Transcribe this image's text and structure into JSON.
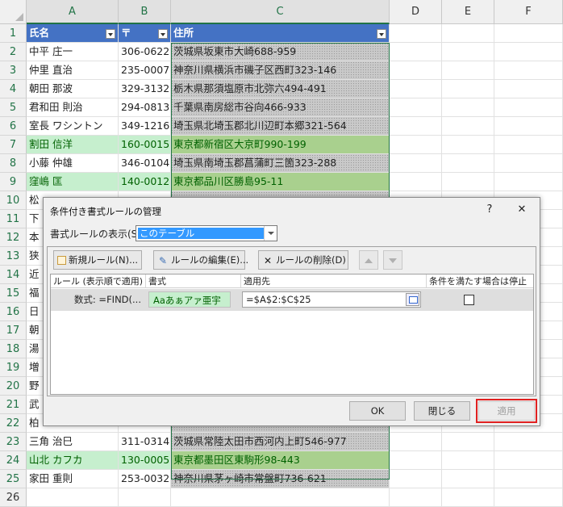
{
  "columns": [
    "A",
    "B",
    "C",
    "D",
    "E",
    "F"
  ],
  "rows": [
    {
      "n": "1",
      "a": "氏名",
      "b": "〒",
      "c": "住所",
      "header": true
    },
    {
      "n": "2",
      "a": "中平 庄一",
      "b": "306-0622",
      "c": "茨城県坂東市大崎688-959"
    },
    {
      "n": "3",
      "a": "仲里 直治",
      "b": "235-0007",
      "c": "神奈川県横浜市磯子区西町323-146"
    },
    {
      "n": "4",
      "a": "朝田 那波",
      "b": "329-3132",
      "c": "栃木県那須塩原市北弥六494-491"
    },
    {
      "n": "5",
      "a": "君和田 則治",
      "b": "294-0813",
      "c": "千葉県南房総市谷向466-933"
    },
    {
      "n": "6",
      "a": "室長 ワシントン",
      "b": "349-1216",
      "c": "埼玉県北埼玉郡北川辺町本郷321-564"
    },
    {
      "n": "7",
      "a": "割田 信洋",
      "b": "160-0015",
      "c": "東京都新宿区大京町990-199",
      "hl": true
    },
    {
      "n": "8",
      "a": "小藤 仲雄",
      "b": "346-0104",
      "c": "埼玉県南埼玉郡菖蒲町三箇323-288"
    },
    {
      "n": "9",
      "a": "窪嶋 匡",
      "b": "140-0012",
      "c": "東京都品川区勝島95-11",
      "hl": true
    },
    {
      "n": "10",
      "a": "松",
      "b": "",
      "c": ""
    },
    {
      "n": "11",
      "a": "下",
      "b": "",
      "c": ""
    },
    {
      "n": "12",
      "a": "本",
      "b": "",
      "c": ""
    },
    {
      "n": "13",
      "a": "狭",
      "b": "",
      "c": ""
    },
    {
      "n": "14",
      "a": "近",
      "b": "",
      "c": ""
    },
    {
      "n": "15",
      "a": "福",
      "b": "",
      "c": ""
    },
    {
      "n": "16",
      "a": "日",
      "b": "",
      "c": ""
    },
    {
      "n": "17",
      "a": "朝",
      "b": "",
      "c": ""
    },
    {
      "n": "18",
      "a": "湯",
      "b": "",
      "c": ""
    },
    {
      "n": "19",
      "a": "増",
      "b": "",
      "c": ""
    },
    {
      "n": "20",
      "a": "野",
      "b": "",
      "c": ""
    },
    {
      "n": "21",
      "a": "武",
      "b": "",
      "c": ""
    },
    {
      "n": "22",
      "a": "柏",
      "b": "",
      "c": ""
    },
    {
      "n": "23",
      "a": "三角 治巳",
      "b": "311-0314",
      "c": "茨城県常陸太田市西河内上町546-977"
    },
    {
      "n": "24",
      "a": "山北 カフカ",
      "b": "130-0005",
      "c": "東京都墨田区東駒形98-443",
      "hl": true
    },
    {
      "n": "25",
      "a": "家田 重則",
      "b": "253-0032",
      "c": "神奈川県茅ヶ崎市常盤町736-621"
    },
    {
      "n": "26",
      "a": "",
      "b": "",
      "c": "",
      "plain": true
    }
  ],
  "dialog": {
    "title": "条件付き書式ルールの管理",
    "help": "?",
    "close": "✕",
    "show_label": "書式ルールの表示(S):",
    "show_value": "このテーブル",
    "new_rule": "新規ルール(N)...",
    "edit_rule": "ルールの編集(E)...",
    "delete_rule": "ルールの削除(D)",
    "col_rule": "ルール (表示順で適用)",
    "col_format": "書式",
    "col_applies": "適用先",
    "col_stop": "条件を満たす場合は停止",
    "rule_name": "数式: =FIND(...",
    "rule_preview": "Aaあぁアァ亜宇",
    "rule_range": "=$A$2:$C$25",
    "ok": "OK",
    "close_btn": "閉じる",
    "apply": "適用"
  }
}
